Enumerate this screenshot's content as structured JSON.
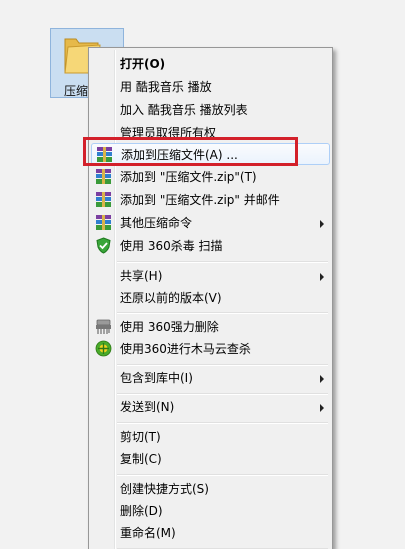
{
  "desktop": {
    "folder_label": "压缩",
    "folder_icon": "folder-icon"
  },
  "menu": {
    "items": [
      {
        "label": "打开(O)",
        "bold": true
      },
      {
        "label": "用 酷我音乐 播放"
      },
      {
        "label": "加入 酷我音乐 播放列表"
      },
      {
        "label": "管理员取得所有权"
      },
      {
        "label": "添加到压缩文件(A) ...",
        "icon": "winrar-icon",
        "highlighted": true
      },
      {
        "label": "添加到 \"压缩文件.zip\"(T)",
        "icon": "winrar-icon"
      },
      {
        "label": "添加到 \"压缩文件.zip\" 并邮件",
        "icon": "winrar-icon"
      },
      {
        "label": "其他压缩命令",
        "icon": "winrar-icon",
        "submenu": true
      },
      {
        "label": "使用 360杀毒 扫描",
        "icon": "shield-icon"
      },
      {
        "label": "共享(H)",
        "submenu": true
      },
      {
        "label": "还原以前的版本(V)"
      },
      {
        "label": "使用 360强力删除",
        "icon": "shredder-icon"
      },
      {
        "label": "使用360进行木马云查杀",
        "icon": "trojan-scan-icon"
      },
      {
        "label": "包含到库中(I)",
        "submenu": true
      },
      {
        "label": "发送到(N)",
        "submenu": true
      },
      {
        "label": "剪切(T)"
      },
      {
        "label": "复制(C)"
      },
      {
        "label": "创建快捷方式(S)"
      },
      {
        "label": "删除(D)"
      },
      {
        "label": "重命名(M)"
      }
    ]
  },
  "colors": {
    "highlight_border": "#d3202a",
    "menu_background": "#f0f0f0",
    "selection_border": "#aecff7"
  }
}
